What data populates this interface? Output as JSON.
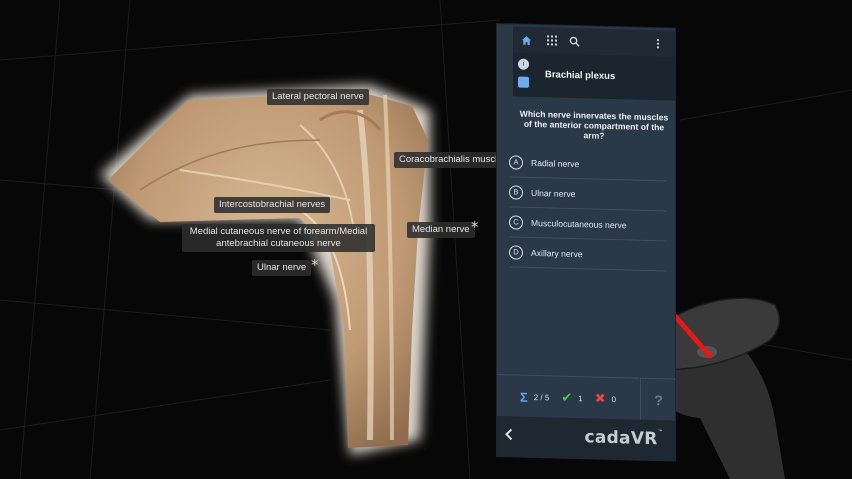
{
  "anatomy_labels": {
    "lateral_pectoral": "Lateral pectoral nerve",
    "coracobrachialis": "Coracobrachialis muscle",
    "intercostobrachial": "Intercostobrachial nerves",
    "medial_cutaneous": "Medial cutaneous nerve of forearm/Medial antebrachial cutaneous nerve",
    "median": "Median nerve",
    "ulnar": "Ulnar nerve",
    "star": "*"
  },
  "panel": {
    "title": "Brachial plexus",
    "question": "Which nerve innervates the muscles of the anterior compartment of the arm?",
    "options": [
      {
        "letter": "A",
        "text": "Radial nerve"
      },
      {
        "letter": "B",
        "text": "Ulnar nerve"
      },
      {
        "letter": "C",
        "text": "Musculocutaneous nerve"
      },
      {
        "letter": "D",
        "text": "Axillary nerve"
      }
    ],
    "stats": {
      "progress": "2 / 5",
      "correct": "1",
      "wrong": "0"
    },
    "help": "?",
    "brand": "cadaVR",
    "brand_mark": "™"
  },
  "icons": {
    "home": "home-icon",
    "grid": "grid-icon",
    "search": "search-icon",
    "more": "more-vertical-icon",
    "info": "info-icon",
    "model": "model-icon",
    "back": "back-icon"
  },
  "colors": {
    "panel_bg": "#2a3848",
    "accent_blue": "#5fa9f2",
    "correct_green": "#3fcf4b",
    "wrong_red": "#e64545",
    "laser_red": "#e51818"
  }
}
